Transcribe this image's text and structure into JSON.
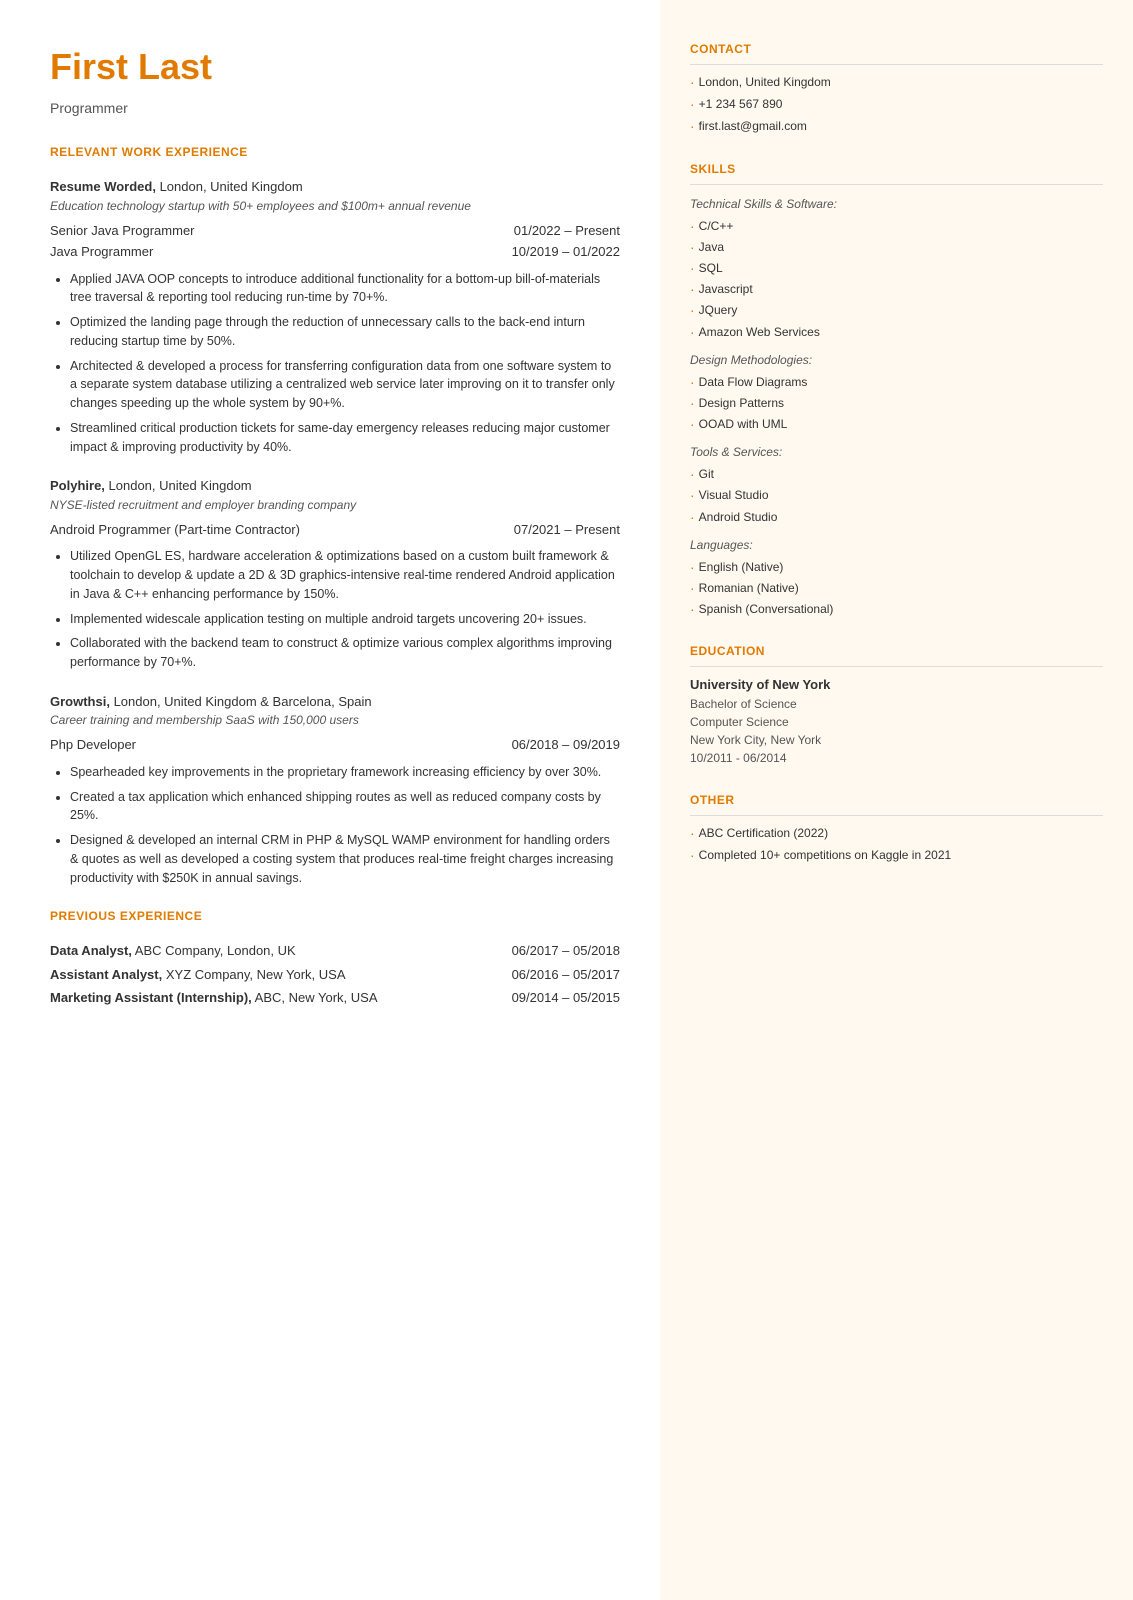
{
  "header": {
    "name": "First Last",
    "title": "Programmer"
  },
  "left": {
    "relevant_work_title": "RELEVANT WORK EXPERIENCE",
    "companies": [
      {
        "name": "Resume Worded,",
        "name_rest": " London, United Kingdom",
        "desc": "Education technology startup with 50+ employees and $100m+ annual revenue",
        "roles": [
          {
            "title": "Senior Java Programmer",
            "date": "01/2022 – Present"
          },
          {
            "title": "Java Programmer",
            "date": "10/2019 – 01/2022"
          }
        ],
        "bullets": [
          "Applied JAVA OOP concepts to introduce additional functionality for a bottom-up bill-of-materials tree traversal & reporting tool reducing run-time by 70+%.",
          "Optimized the landing page through the reduction of unnecessary calls to the back-end inturn reducing startup time by 50%.",
          "Architected & developed a process for transferring configuration data from one software system to a separate system database utilizing a centralized web service later improving on it to transfer only changes speeding up the whole system by 90+%.",
          "Streamlined critical production tickets for same-day emergency releases reducing major customer impact & improving productivity by 40%."
        ]
      },
      {
        "name": "Polyhire,",
        "name_rest": " London, United Kingdom",
        "desc": "NYSE-listed recruitment and employer branding company",
        "roles": [
          {
            "title": "Android Programmer (Part-time Contractor)",
            "date": "07/2021 – Present"
          }
        ],
        "bullets": [
          "Utilized OpenGL ES, hardware acceleration & optimizations based on a custom built framework & toolchain to develop & update a 2D & 3D graphics-intensive real-time rendered Android application in Java & C++ enhancing performance by 150%.",
          "Implemented widescale application testing on multiple android targets uncovering 20+ issues.",
          "Collaborated with the backend team to construct & optimize various complex algorithms improving performance by 70+%."
        ]
      },
      {
        "name": "Growthsi,",
        "name_rest": " London, United Kingdom & Barcelona, Spain",
        "desc": "Career training and membership SaaS with 150,000 users",
        "roles": [
          {
            "title": "Php Developer",
            "date": "06/2018 – 09/2019"
          }
        ],
        "bullets": [
          "Spearheaded key improvements in the proprietary framework increasing efficiency by over 30%.",
          "Created a tax application which enhanced shipping routes as well as reduced company costs by 25%.",
          "Designed & developed an internal CRM in PHP & MySQL WAMP environment for handling orders & quotes as well as developed a costing system that produces real-time freight charges increasing productivity with $250K in annual savings."
        ]
      }
    ],
    "previous_work_title": "PREVIOUS EXPERIENCE",
    "previous_roles": [
      {
        "bold": "Data Analyst,",
        "rest": " ABC Company, London, UK",
        "date": "06/2017 – 05/2018"
      },
      {
        "bold": "Assistant Analyst,",
        "rest": " XYZ Company, New York, USA",
        "date": "06/2016 – 05/2017"
      },
      {
        "bold": "Marketing Assistant (Internship),",
        "rest": " ABC, New York, USA",
        "date": "09/2014 – 05/2015"
      }
    ]
  },
  "right": {
    "contact_title": "CONTACT",
    "contact_items": [
      "London, United Kingdom",
      "+1 234 567 890",
      "first.last@gmail.com"
    ],
    "skills_title": "SKILLS",
    "skills_categories": [
      {
        "label": "Technical Skills & Software:",
        "items": [
          "C/C++",
          "Java",
          "SQL",
          "Javascript",
          "JQuery",
          "Amazon Web Services"
        ]
      },
      {
        "label": "Design Methodologies:",
        "items": [
          "Data Flow Diagrams",
          "Design Patterns",
          "OOAD with UML"
        ]
      },
      {
        "label": "Tools & Services:",
        "items": [
          "Git",
          "Visual Studio",
          "Android Studio"
        ]
      },
      {
        "label": "Languages:",
        "items": [
          "English (Native)",
          "Romanian (Native)",
          "Spanish (Conversational)"
        ]
      }
    ],
    "education_title": "EDUCATION",
    "education": [
      {
        "institution": "University of New York",
        "degree": "Bachelor of Science",
        "field": "Computer Science",
        "location": "New York City, New York",
        "dates": "10/2011 - 06/2014"
      }
    ],
    "other_title": "OTHER",
    "other_items": [
      "ABC Certification (2022)",
      "Completed 10+ competitions on Kaggle in 2021"
    ]
  }
}
